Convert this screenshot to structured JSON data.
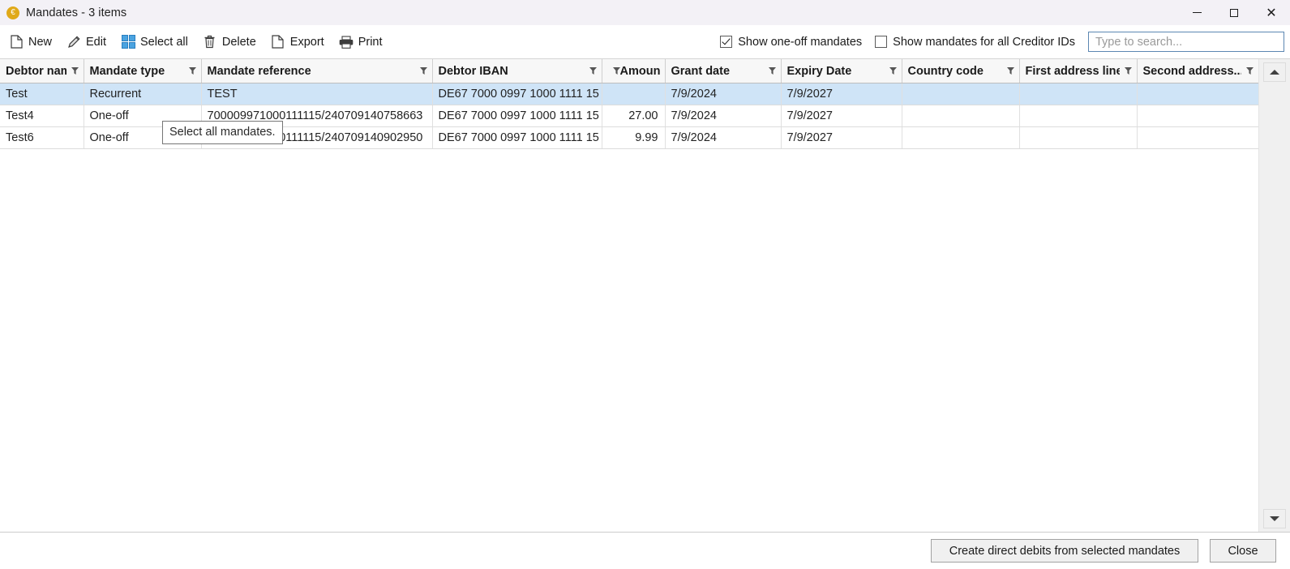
{
  "window": {
    "title": "Mandates - 3 items",
    "app_icon": "euro-coin-icon",
    "controls": {
      "minimize": "minimize-icon",
      "maximize": "maximize-icon",
      "close": "close-icon"
    }
  },
  "toolbar": {
    "buttons": [
      {
        "label": "New",
        "icon": "new-document-icon"
      },
      {
        "label": "Edit",
        "icon": "pencil-icon"
      },
      {
        "label": "Select all",
        "icon": "select-all-grid-icon"
      },
      {
        "label": "Delete",
        "icon": "trash-icon"
      },
      {
        "label": "Export",
        "icon": "document-icon"
      },
      {
        "label": "Print",
        "icon": "printer-icon"
      }
    ],
    "checkboxes": [
      {
        "label": "Show one-off mandates",
        "checked": true
      },
      {
        "label": "Show mandates for all Creditor IDs",
        "checked": false
      }
    ],
    "search": {
      "placeholder": "Type to search...",
      "value": ""
    }
  },
  "tooltip": {
    "text": "Select all mandates.",
    "visible": true
  },
  "grid": {
    "columns": [
      {
        "label": "Debtor name",
        "align": "left",
        "filter": true
      },
      {
        "label": "Mandate type",
        "align": "left",
        "filter": true
      },
      {
        "label": "Mandate reference",
        "align": "left",
        "filter": true
      },
      {
        "label": "Debtor IBAN",
        "align": "left",
        "filter": true
      },
      {
        "label": "Amount",
        "align": "right",
        "filter": true
      },
      {
        "label": "Grant date",
        "align": "left",
        "filter": true
      },
      {
        "label": "Expiry Date",
        "align": "left",
        "filter": true
      },
      {
        "label": "Country code",
        "align": "left",
        "filter": true
      },
      {
        "label": "First address line",
        "align": "left",
        "filter": true
      },
      {
        "label": "Second address...",
        "align": "left",
        "filter": true
      }
    ],
    "rows": [
      {
        "selected": true,
        "cells": [
          "Test",
          "Recurrent",
          "TEST",
          "DE67 7000 0997 1000 1111 15",
          "",
          "7/9/2024",
          "7/9/2027",
          "",
          "",
          ""
        ]
      },
      {
        "selected": false,
        "cells": [
          "Test4",
          "One-off",
          "700009971000111115/240709140758663",
          "DE67 7000 0997 1000 1111 15",
          "27.00",
          "7/9/2024",
          "7/9/2027",
          "",
          "",
          ""
        ]
      },
      {
        "selected": false,
        "cells": [
          "Test6",
          "One-off",
          "700009971000111115/240709140902950",
          "DE67 7000 0997 1000 1111 15",
          "9.99",
          "7/9/2024",
          "7/9/2027",
          "",
          "",
          ""
        ]
      }
    ]
  },
  "scrollbar": {
    "up_icon": "scroll-up-arrow-icon",
    "down_icon": "scroll-down-arrow-icon"
  },
  "footer": {
    "primary_button": "Create direct debits from selected mandates",
    "close_button": "Close"
  },
  "colors": {
    "titlebar_bg": "#f3f1f6",
    "selection_bg": "#cfe4f7",
    "header_bg": "#f7f7f7",
    "accent_border": "#5c87b2",
    "app_icon": "#e0a918"
  }
}
